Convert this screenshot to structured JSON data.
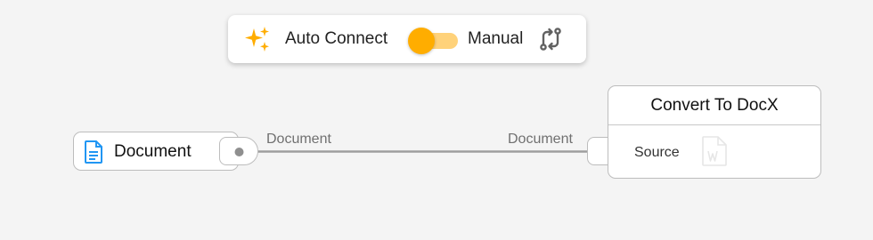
{
  "mode_toolbar": {
    "auto_label": "Auto Connect",
    "manual_label": "Manual",
    "toggle_state": "auto",
    "icons": {
      "auto": "sparkle-icon",
      "manual": "manual-connect-icon"
    },
    "colors": {
      "accent": "#ffad00",
      "track": "#ffd27a"
    }
  },
  "source_node": {
    "title": "Document",
    "icon": "document-icon",
    "icon_color": "#2196f3"
  },
  "connection": {
    "output_label": "Document",
    "input_label": "Document",
    "line_color": "#9e9e9e"
  },
  "target_node": {
    "title": "Convert To DocX",
    "input_port_label": "Source",
    "icon": "docx-file-icon"
  }
}
